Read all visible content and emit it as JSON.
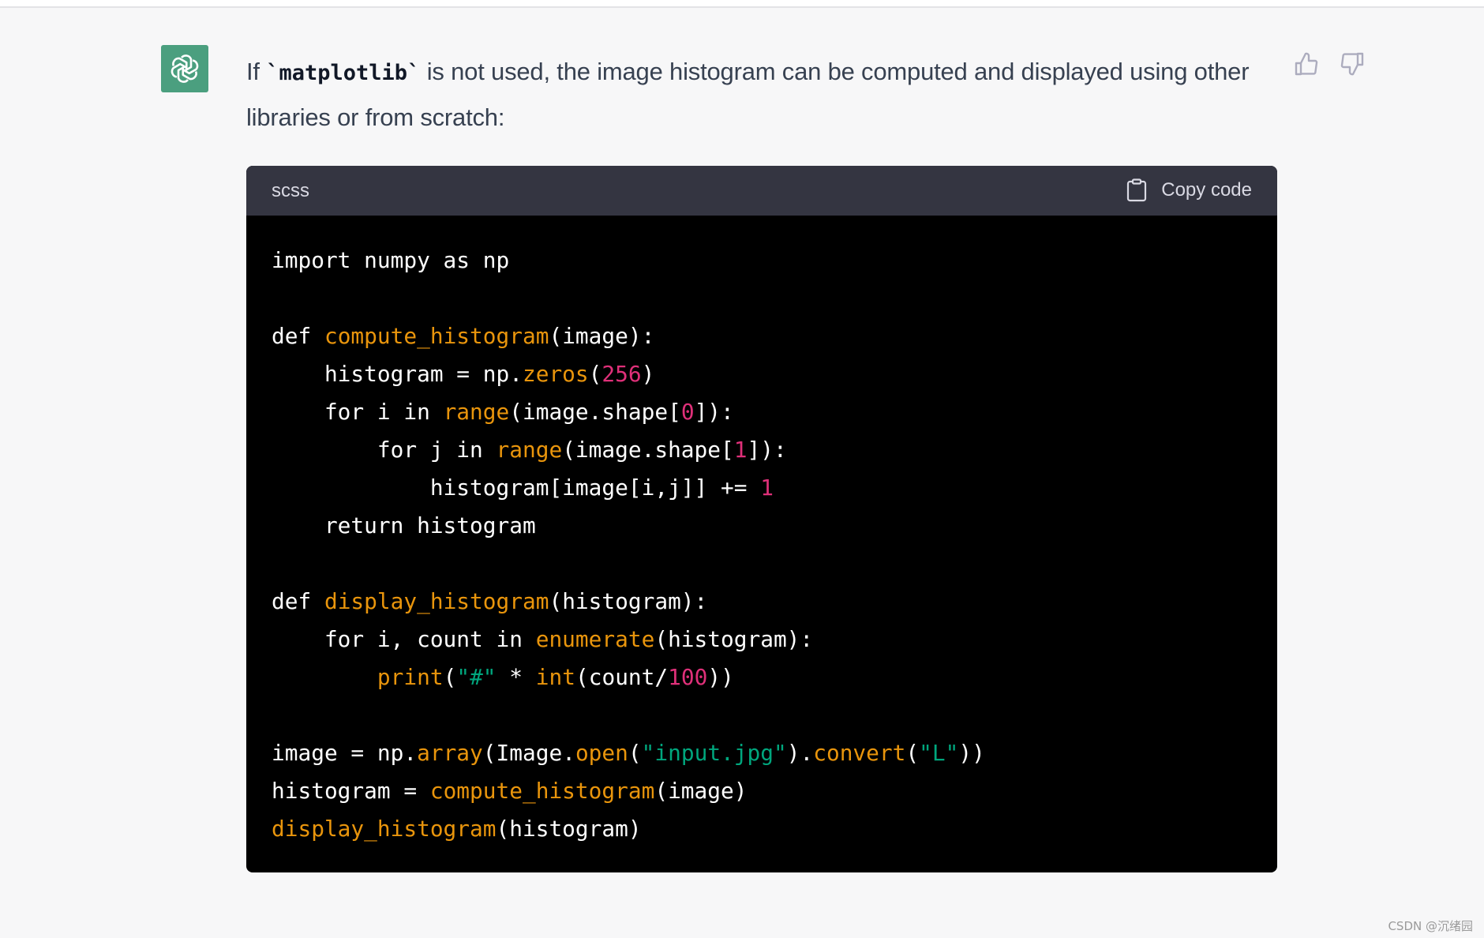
{
  "message": {
    "prefix": "If ",
    "inline_code": "`matplotlib`",
    "suffix": " is not used, the image histogram can be computed and displayed using other libraries or from scratch:"
  },
  "feedback": {
    "thumbs_up_label": "Like",
    "thumbs_down_label": "Dislike"
  },
  "codeblock": {
    "language": "scss",
    "copy_label": "Copy code",
    "lines": [
      [
        {
          "t": "import numpy as np",
          "c": "plain"
        }
      ],
      [],
      [
        {
          "t": "def ",
          "c": "plain"
        },
        {
          "t": "compute_histogram",
          "c": "fn"
        },
        {
          "t": "(image):",
          "c": "plain"
        }
      ],
      [
        {
          "t": "    histogram = np.",
          "c": "plain"
        },
        {
          "t": "zeros",
          "c": "fn"
        },
        {
          "t": "(",
          "c": "plain"
        },
        {
          "t": "256",
          "c": "num"
        },
        {
          "t": ")",
          "c": "plain"
        }
      ],
      [
        {
          "t": "    for i in ",
          "c": "plain"
        },
        {
          "t": "range",
          "c": "fn"
        },
        {
          "t": "(image.shape[",
          "c": "plain"
        },
        {
          "t": "0",
          "c": "num"
        },
        {
          "t": "]):",
          "c": "plain"
        }
      ],
      [
        {
          "t": "        for j in ",
          "c": "plain"
        },
        {
          "t": "range",
          "c": "fn"
        },
        {
          "t": "(image.shape[",
          "c": "plain"
        },
        {
          "t": "1",
          "c": "num"
        },
        {
          "t": "]):",
          "c": "plain"
        }
      ],
      [
        {
          "t": "            histogram[image[i,j]] += ",
          "c": "plain"
        },
        {
          "t": "1",
          "c": "num"
        }
      ],
      [
        {
          "t": "    return histogram",
          "c": "plain"
        }
      ],
      [],
      [
        {
          "t": "def ",
          "c": "plain"
        },
        {
          "t": "display_histogram",
          "c": "fn"
        },
        {
          "t": "(histogram):",
          "c": "plain"
        }
      ],
      [
        {
          "t": "    for i, count in ",
          "c": "plain"
        },
        {
          "t": "enumerate",
          "c": "fn"
        },
        {
          "t": "(histogram):",
          "c": "plain"
        }
      ],
      [
        {
          "t": "        ",
          "c": "plain"
        },
        {
          "t": "print",
          "c": "fn"
        },
        {
          "t": "(",
          "c": "plain"
        },
        {
          "t": "\"#\"",
          "c": "str"
        },
        {
          "t": " * ",
          "c": "plain"
        },
        {
          "t": "int",
          "c": "fn"
        },
        {
          "t": "(count/",
          "c": "plain"
        },
        {
          "t": "100",
          "c": "num"
        },
        {
          "t": "))",
          "c": "plain"
        }
      ],
      [],
      [
        {
          "t": "image = np.",
          "c": "plain"
        },
        {
          "t": "array",
          "c": "fn"
        },
        {
          "t": "(Image.",
          "c": "plain"
        },
        {
          "t": "open",
          "c": "fn"
        },
        {
          "t": "(",
          "c": "plain"
        },
        {
          "t": "\"input.jpg\"",
          "c": "str"
        },
        {
          "t": ").",
          "c": "plain"
        },
        {
          "t": "convert",
          "c": "fn"
        },
        {
          "t": "(",
          "c": "plain"
        },
        {
          "t": "\"L\"",
          "c": "str"
        },
        {
          "t": "))",
          "c": "plain"
        }
      ],
      [
        {
          "t": "histogram = ",
          "c": "plain"
        },
        {
          "t": "compute_histogram",
          "c": "fn"
        },
        {
          "t": "(image)",
          "c": "plain"
        }
      ],
      [
        {
          "t": "display_histogram",
          "c": "fn"
        },
        {
          "t": "(histogram)",
          "c": "plain"
        }
      ]
    ]
  },
  "colors": {
    "avatar_bg": "#4b9f7f",
    "code_function": "#e9950c",
    "code_number": "#df3079",
    "code_string": "#00a67d"
  },
  "watermark": "CSDN @沉绪园"
}
